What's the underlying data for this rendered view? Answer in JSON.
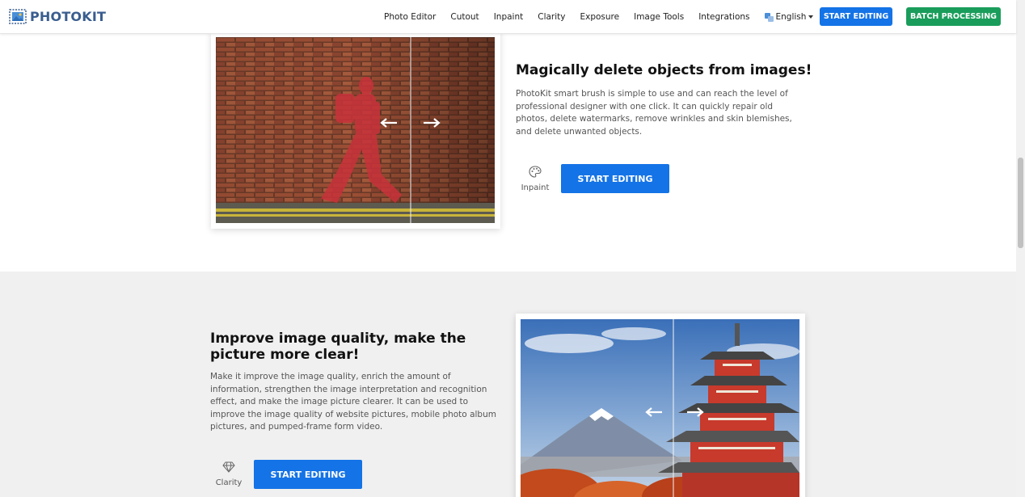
{
  "header": {
    "logo_text": "PHOTOKIT",
    "nav": [
      {
        "label": "Photo Editor"
      },
      {
        "label": "Cutout"
      },
      {
        "label": "Inpaint"
      },
      {
        "label": "Clarity"
      },
      {
        "label": "Exposure"
      },
      {
        "label": "Image Tools"
      },
      {
        "label": "Integrations"
      }
    ],
    "language": "English",
    "start_editing": "START EDITING",
    "batch_processing": "BATCH PROCESSING"
  },
  "section_inpaint": {
    "heading": "Magically delete objects from images!",
    "description": "PhotoKit smart brush is simple to use and can reach the level of professional designer with one click. It can quickly repair old photos, delete watermarks, remove wrinkles and skin blemishes, and delete unwanted objects.",
    "tool_label": "Inpaint",
    "tool_icon": "palette-icon",
    "button": "START EDITING"
  },
  "section_clarity": {
    "heading": "Improve image quality, make the picture more clear!",
    "description": "Make it improve the image quality, enrich the amount of information, strengthen the image interpretation and recognition effect, and make the image picture clearer. It can be used to improve the image quality of website pictures, mobile photo album pictures, and pumped-frame form video.",
    "tool_label": "Clarity",
    "tool_icon": "diamond-icon",
    "button": "START EDITING"
  },
  "colors": {
    "primary_blue": "#1473e6",
    "batch_green": "#1a9d5b",
    "section_gray": "#f0f0f0"
  }
}
